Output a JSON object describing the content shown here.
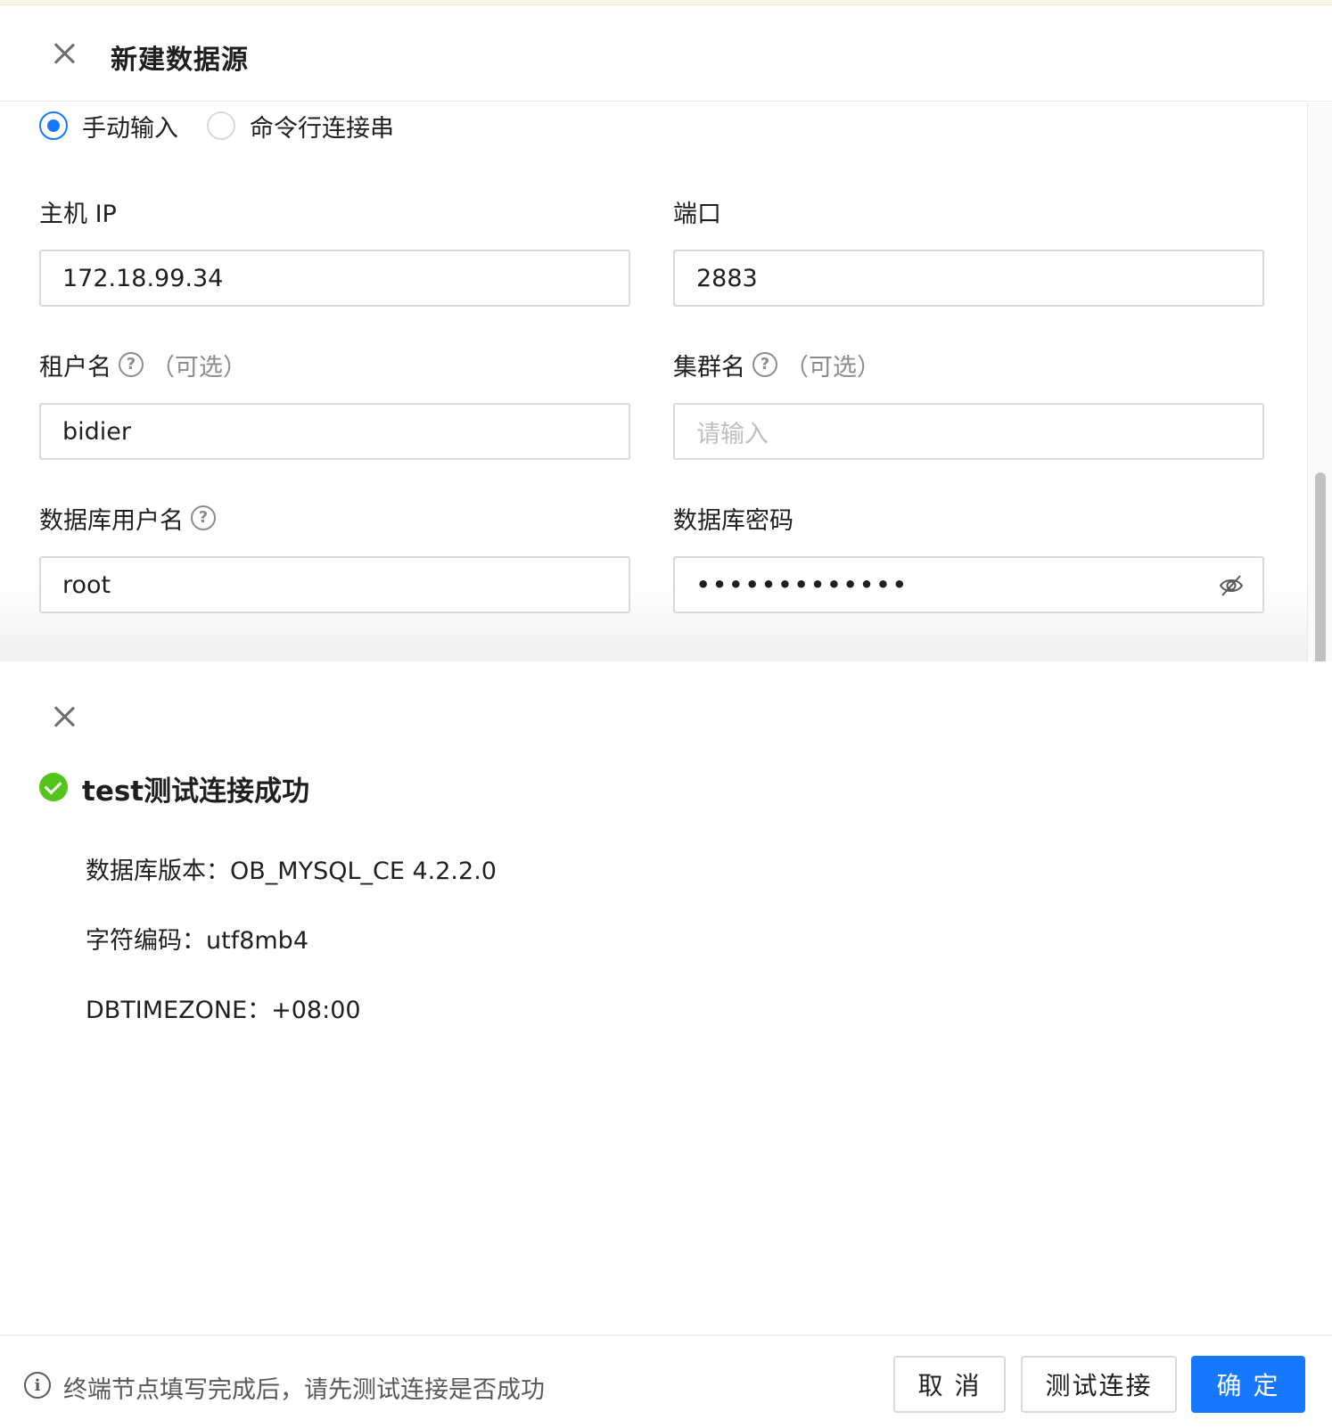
{
  "header": {
    "title": "新建数据源"
  },
  "mode": {
    "options": [
      {
        "label": "手动输入",
        "checked": true
      },
      {
        "label": "命令行连接串",
        "checked": false
      }
    ]
  },
  "form": {
    "host": {
      "label": "主机 IP",
      "value": "172.18.99.34"
    },
    "port": {
      "label": "端口",
      "value": "2883"
    },
    "tenant": {
      "label": "租户名",
      "optional": "（可选）",
      "value": "bidier"
    },
    "cluster": {
      "label": "集群名",
      "optional": "（可选）",
      "value": "",
      "placeholder": "请输入"
    },
    "db_user": {
      "label": "数据库用户名",
      "value": "root"
    },
    "db_password": {
      "label": "数据库密码",
      "masked": "•••••••••••••"
    }
  },
  "result": {
    "title": "test测试连接成功",
    "lines": [
      "数据库版本：OB_MYSQL_CE 4.2.2.0",
      "字符编码：utf8mb4",
      "DBTIMEZONE：+08:00"
    ]
  },
  "footer": {
    "tip": "终端节点填写完成后，请先测试连接是否成功",
    "cancel": "取 消",
    "test": "测试连接",
    "confirm": "确 定"
  },
  "colors": {
    "primary": "#1677ff",
    "success": "#52c41a"
  }
}
